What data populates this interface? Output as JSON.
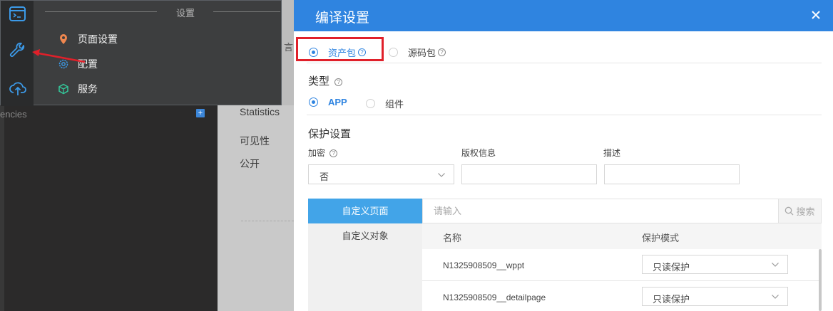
{
  "background": {
    "deps_label": "encies",
    "plus_label": "+",
    "mid_trunc": "言",
    "statistics_label": "Statistics",
    "visibility_label": "可见性",
    "visibility_value": "公开"
  },
  "settings_popover": {
    "title": "设置",
    "items": [
      {
        "label": "页面设置",
        "icon": "location-pin-icon"
      },
      {
        "label": "配置",
        "icon": "gear-icon"
      },
      {
        "label": "服务",
        "icon": "cube-icon"
      }
    ],
    "rail_icons": [
      "terminal-icon",
      "wrench-icon",
      "cloud-upload-icon"
    ]
  },
  "dialog": {
    "title": "编译设置",
    "package_options": [
      {
        "label": "资产包",
        "help": "?",
        "selected": true
      },
      {
        "label": "源码包",
        "help": "?",
        "selected": false
      }
    ],
    "type_section": {
      "title": "类型",
      "help": "?",
      "options": [
        {
          "label": "APP",
          "selected": true
        },
        {
          "label": "组件",
          "selected": false
        }
      ]
    },
    "protection": {
      "title": "保护设置",
      "encrypt_label": "加密",
      "encrypt_help": "?",
      "encrypt_value": "否",
      "copyright_label": "版权信息",
      "copyright_value": "",
      "description_label": "描述",
      "description_value": ""
    },
    "tabs": [
      {
        "label": "自定义页面",
        "active": true
      },
      {
        "label": "自定义对象",
        "active": false
      }
    ],
    "search": {
      "placeholder": "请输入",
      "button_label": "搜索"
    },
    "table": {
      "columns": [
        "名称",
        "保护模式"
      ],
      "rows": [
        {
          "name": "N1325908509__wppt",
          "mode": "只读保护"
        },
        {
          "name": "N1325908509__detailpage",
          "mode": "只读保护"
        }
      ]
    },
    "accent_color": "#2f84e0",
    "highlight_color": "#e0202a"
  }
}
